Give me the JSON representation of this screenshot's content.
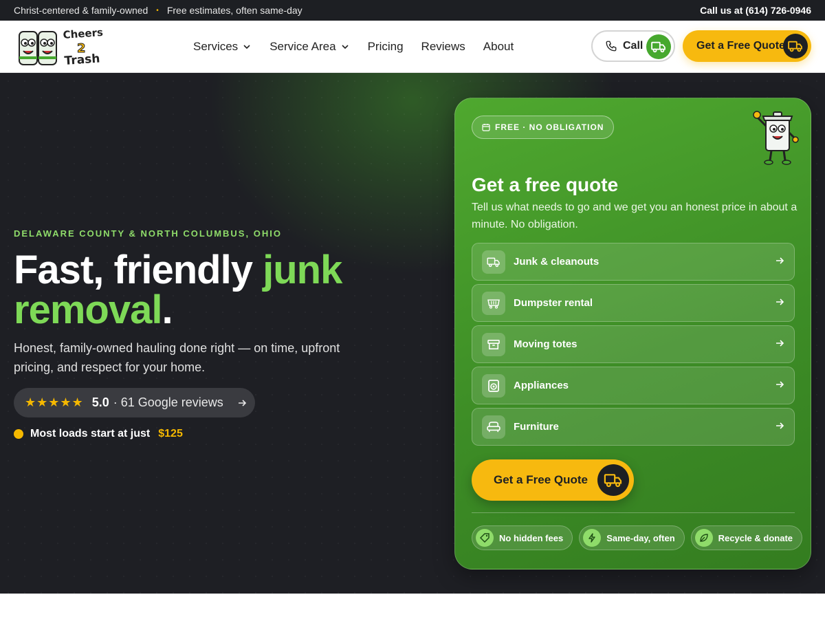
{
  "topbar": {
    "tagline_1": "Christ-centered & family-owned",
    "tagline_2": "Free estimates, often same-day",
    "call_text": "Call us at (614) 726-0946"
  },
  "header": {
    "logo_text": "Cheers 2 Trash",
    "nav": [
      {
        "label": "Services",
        "dropdown": true
      },
      {
        "label": "Service Area",
        "dropdown": true
      },
      {
        "label": "Pricing",
        "dropdown": false
      },
      {
        "label": "Reviews",
        "dropdown": false
      },
      {
        "label": "About",
        "dropdown": false
      }
    ],
    "call_button": "Call",
    "quote_button": "Get a Free Quote"
  },
  "hero": {
    "eyebrow": "DELAWARE COUNTY & NORTH COLUMBUS, OHIO",
    "headline_white": "Fast, friendly ",
    "headline_green": "junk removal",
    "headline_end": ".",
    "subhead": "Honest, family-owned hauling done right — on time, upfront pricing, and respect for your home.",
    "stars": "★★★★★",
    "rating": "5.0",
    "reviews_text": "· 61 Google reviews",
    "price_text": "Most loads start at just",
    "price_value": "$125"
  },
  "card": {
    "badge": "FREE · NO OBLIGATION",
    "title": "Get a free quote",
    "description": "Tell us what needs to go and we get you an honest price in about a minute. No obligation.",
    "services": [
      {
        "label": "Junk & cleanouts",
        "icon": "truck-icon"
      },
      {
        "label": "Dumpster rental",
        "icon": "dumpster-icon"
      },
      {
        "label": "Moving totes",
        "icon": "tote-icon"
      },
      {
        "label": "Appliances",
        "icon": "washer-icon"
      },
      {
        "label": "Furniture",
        "icon": "armchair-icon"
      }
    ],
    "cta": "Get a Free Quote",
    "chips": [
      {
        "label": "No hidden fees",
        "icon": "tag-icon"
      },
      {
        "label": "Same-day, often",
        "icon": "lightning-icon"
      },
      {
        "label": "Recycle & donate",
        "icon": "leaf-icon"
      }
    ]
  },
  "colors": {
    "brand_green": "#46a82e",
    "accent_yellow": "#f7b90f",
    "dark": "#1e1f24"
  }
}
